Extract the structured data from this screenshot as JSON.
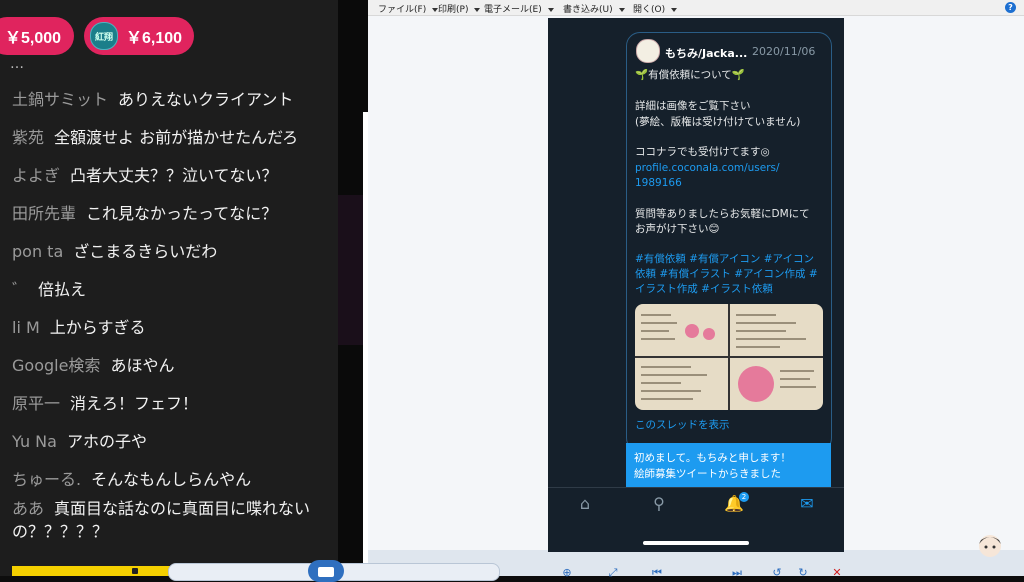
{
  "chat": {
    "superchats": [
      {
        "amount": "￥5,000"
      },
      {
        "avatar_text": "紅翔",
        "amount": "￥6,100"
      }
    ],
    "top_cut_text": "…",
    "messages": [
      {
        "author": "土鍋サミット",
        "text": "ありえないクライアント"
      },
      {
        "author": "紫苑",
        "text": "全額渡せよ お前が描かせたんだろ"
      },
      {
        "author": "よよぎ",
        "text": "凸者大丈夫？？泣いてない？"
      },
      {
        "author": "田所先輩",
        "text": "これ見なかったってなに？"
      },
      {
        "author": "pon ta",
        "text": "ざこまるきらいだわ"
      },
      {
        "author": "゛",
        "text": "倍払え"
      },
      {
        "author": "li M",
        "text": "上からすぎる"
      },
      {
        "author": "Google検索",
        "text": "あほやん"
      },
      {
        "author": "原平一",
        "text": "消えろ！フェフ！"
      },
      {
        "author": "Yu Na",
        "text": "アホの子や"
      },
      {
        "author": "ちゅーる.",
        "text": "そんなもんしらんやん"
      },
      {
        "author": "ああ",
        "text": "真面目な話なのに真面目に喋れないの？？？？？"
      }
    ]
  },
  "viewer": {
    "menu": [
      "ファイル(F)",
      "印刷(P)",
      "電子メール(E)",
      "書き込み(U)",
      "開く(O)"
    ],
    "help_icon": "?"
  },
  "tweet": {
    "name": "もちみ/Jacka...",
    "date": "2020/11/06",
    "lines": [
      "🌱有償依頼について🌱",
      "",
      "詳細は画像をご覧下さい",
      "(夢絵、版権は受け付けていません)",
      "",
      "ココナラでも受付けてます◎",
      "profile.coconala.com/users/",
      "1989166",
      "",
      "質問等ありましたらお気軽にDMにて",
      "お声がけ下さい😊",
      "",
      "#有償依頼 #有償アイコン #アイコン",
      "依頼 #有償イラスト #アイコン作成 #",
      "イラスト作成 #イラスト依頼"
    ],
    "thread_link": "このスレッドを表示",
    "reply_lines": [
      "初めまして。もちみと申します！",
      "絵師募集ツイートからきました"
    ],
    "notif_count": "2"
  }
}
